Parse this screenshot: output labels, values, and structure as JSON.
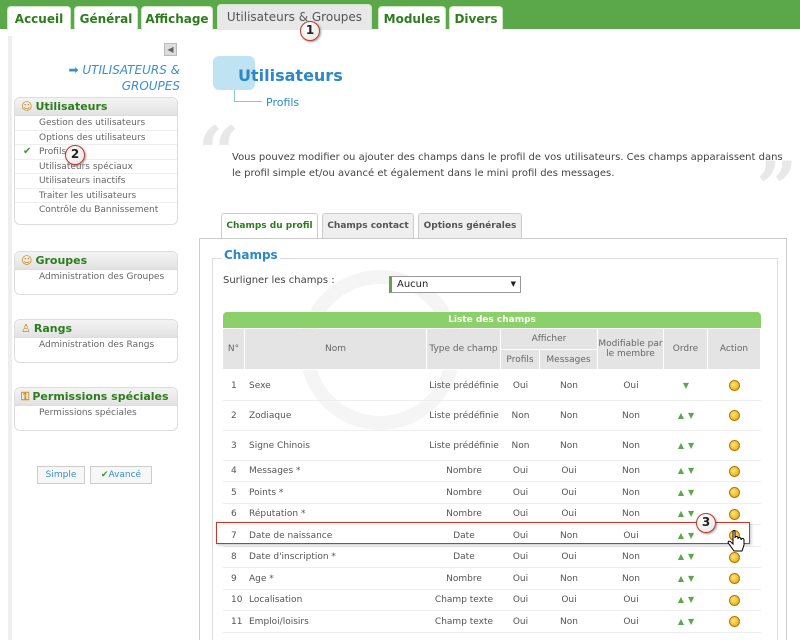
{
  "top_tabs": [
    {
      "label": "Accueil"
    },
    {
      "label": "Général"
    },
    {
      "label": "Affichage"
    },
    {
      "label": "Utilisateurs & Groupes"
    },
    {
      "label": "Modules"
    },
    {
      "label": "Divers"
    }
  ],
  "markers": [
    "1",
    "2",
    "3"
  ],
  "sidebar": {
    "collapse_glyph": "◀",
    "title_line1": "➡ UTILISATEURS &",
    "title_line2": "GROUPES",
    "sections": [
      {
        "title": "Utilisateurs",
        "items": [
          "Gestion des utilisateurs",
          "Options des utilisateurs",
          "Profils",
          "Utilisateurs spéciaux",
          "Utilisateurs inactifs",
          "Traiter les utilisateurs",
          "Contrôle du Bannissement"
        ]
      },
      {
        "title": "Groupes",
        "items": [
          "Administration des Groupes"
        ]
      },
      {
        "title": "Rangs",
        "items": [
          "Administration des Rangs"
        ]
      },
      {
        "title": "Permissions spéciales",
        "items": [
          "Permissions spéciales"
        ]
      }
    ],
    "mode_simple": "Simple",
    "mode_advanced": "Avancé"
  },
  "header": {
    "title": "Utilisateurs",
    "subtitle": "Profils",
    "intro": "Vous pouvez modifier ou ajouter des champs dans le profil de vos utilisateurs. Ces champs apparaissent dans le profil simple et/ou avancé et également dans le mini profil des messages."
  },
  "content_tabs": [
    {
      "label": "Champs du profil"
    },
    {
      "label": "Champs contact"
    },
    {
      "label": "Options générales"
    }
  ],
  "champs": {
    "legend": "Champs",
    "highlight_label": "Surligner les champs :",
    "highlight_value": "Aucun"
  },
  "table": {
    "caption": "Liste des champs",
    "headers": {
      "num": "N°",
      "name": "Nom",
      "type": "Type de champ",
      "show": "Afficher",
      "profiles": "Profils",
      "messages": "Messages",
      "editable": "Modifiable par le membre",
      "order": "Ordre",
      "action": "Action"
    },
    "rows": [
      {
        "n": "1",
        "name": "Sexe",
        "type": "Liste prédéfinie",
        "profiles": "Oui",
        "messages": "Non",
        "editable": "Oui",
        "order": "down"
      },
      {
        "n": "2",
        "name": "Zodiaque",
        "type": "Liste prédéfinie",
        "profiles": "Non",
        "messages": "Non",
        "editable": "Non",
        "order": "both"
      },
      {
        "n": "3",
        "name": "Signe Chinois",
        "type": "Liste prédéfinie",
        "profiles": "Non",
        "messages": "Non",
        "editable": "Non",
        "order": "both"
      },
      {
        "n": "4",
        "name": "Messages *",
        "type": "Nombre",
        "profiles": "Oui",
        "messages": "Oui",
        "editable": "Non",
        "order": "both"
      },
      {
        "n": "5",
        "name": "Points *",
        "type": "Nombre",
        "profiles": "Oui",
        "messages": "Oui",
        "editable": "Non",
        "order": "both"
      },
      {
        "n": "6",
        "name": "Réputation *",
        "type": "Nombre",
        "profiles": "Oui",
        "messages": "Oui",
        "editable": "Non",
        "order": "both"
      },
      {
        "n": "7",
        "name": "Date de naissance",
        "type": "Date",
        "profiles": "Oui",
        "messages": "Non",
        "editable": "Oui",
        "order": "both"
      },
      {
        "n": "8",
        "name": "Date d'inscription *",
        "type": "Date",
        "profiles": "Oui",
        "messages": "Oui",
        "editable": "Non",
        "order": "both"
      },
      {
        "n": "9",
        "name": "Age *",
        "type": "Nombre",
        "profiles": "Oui",
        "messages": "Non",
        "editable": "Non",
        "order": "both"
      },
      {
        "n": "10",
        "name": "Localisation",
        "type": "Champ texte",
        "profiles": "Oui",
        "messages": "Oui",
        "editable": "Oui",
        "order": "both"
      },
      {
        "n": "11",
        "name": "Emploi/loisirs",
        "type": "Champ texte",
        "profiles": "Oui",
        "messages": "Non",
        "editable": "Oui",
        "order": "both"
      }
    ]
  }
}
